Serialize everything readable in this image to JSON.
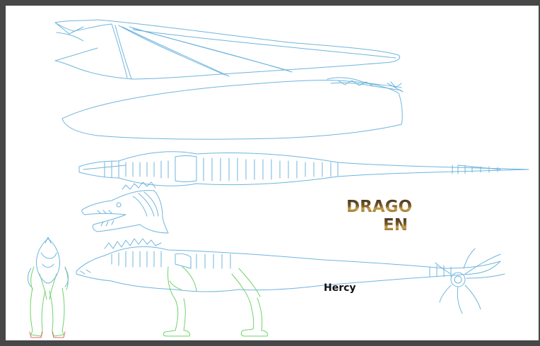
{
  "logo": {
    "line1": "DRAGO",
    "line2": "EN"
  },
  "caption": "Hercy",
  "colors": {
    "background": "#474747",
    "paper": "#ffffff",
    "line_blue": "#6fb5dd",
    "line_green": "#6fd36a",
    "line_red": "#e06a6a",
    "logo_brown": "#6b4a23"
  }
}
